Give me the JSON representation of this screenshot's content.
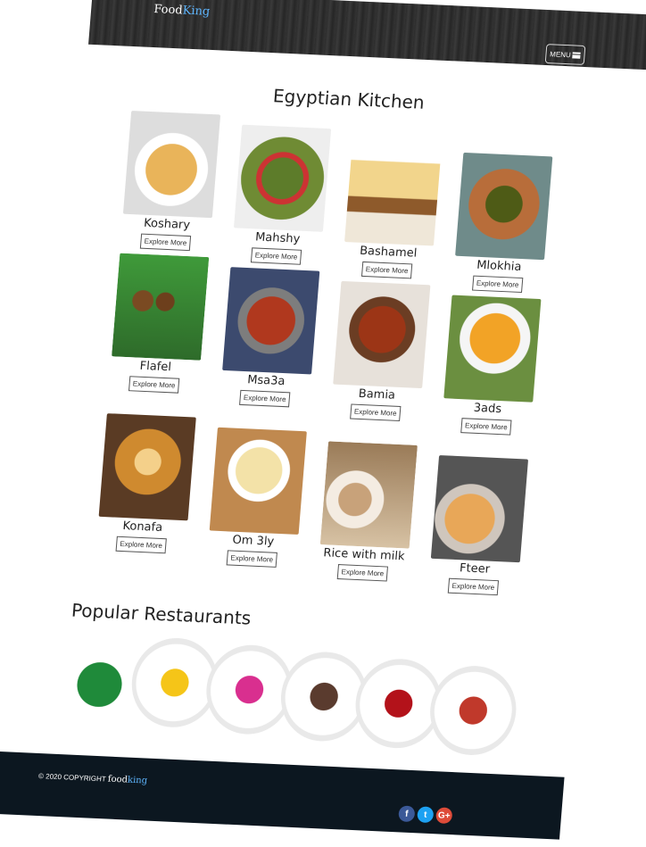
{
  "header": {
    "logo_food": "Food",
    "logo_king": "King",
    "menu_label": "MENU"
  },
  "kitchen": {
    "title": "Egyptian Kitchen",
    "dishes": [
      {
        "name": "Koshary",
        "button": "Explore More"
      },
      {
        "name": "Mahshy",
        "button": "Explore More"
      },
      {
        "name": "Bashamel",
        "button": "Explore More"
      },
      {
        "name": "Mlokhia",
        "button": "Explore More"
      },
      {
        "name": "Flafel",
        "button": "Explore More"
      },
      {
        "name": "Msa3a",
        "button": "Explore More"
      },
      {
        "name": "Bamia",
        "button": "Explore More"
      },
      {
        "name": "3ads",
        "button": "Explore More"
      },
      {
        "name": "Konafa",
        "button": "Explore More"
      },
      {
        "name": "Om 3ly",
        "button": "Explore More"
      },
      {
        "name": "Rice with milk",
        "button": "Explore More"
      },
      {
        "name": "Fteer",
        "button": "Explore More"
      }
    ]
  },
  "restaurants": {
    "title": "Popular Restaurants",
    "logos": [
      {
        "name": "abu-hassan-logo",
        "color": "#1f8a3a"
      },
      {
        "name": "falafel-logo",
        "color": "#f5c518"
      },
      {
        "name": "alamashy-logo",
        "color": "#d92f8f"
      },
      {
        "name": "alhogary-logo",
        "color": "#5a3b2e"
      },
      {
        "name": "kebda-elbrens-logo",
        "color": "#b3121a"
      },
      {
        "name": "beit-elmashwiat-logo",
        "color": "#c0392b"
      }
    ]
  },
  "footer": {
    "copyright": "© 2020 COPYRIGHT",
    "logo_food": "food",
    "logo_king": "king",
    "social": [
      {
        "name": "facebook-icon",
        "glyph": "f",
        "color": "#3b5998"
      },
      {
        "name": "twitter-icon",
        "glyph": "t",
        "color": "#1da1f2"
      },
      {
        "name": "google-plus-icon",
        "glyph": "G+",
        "color": "#dd4b39"
      }
    ]
  }
}
